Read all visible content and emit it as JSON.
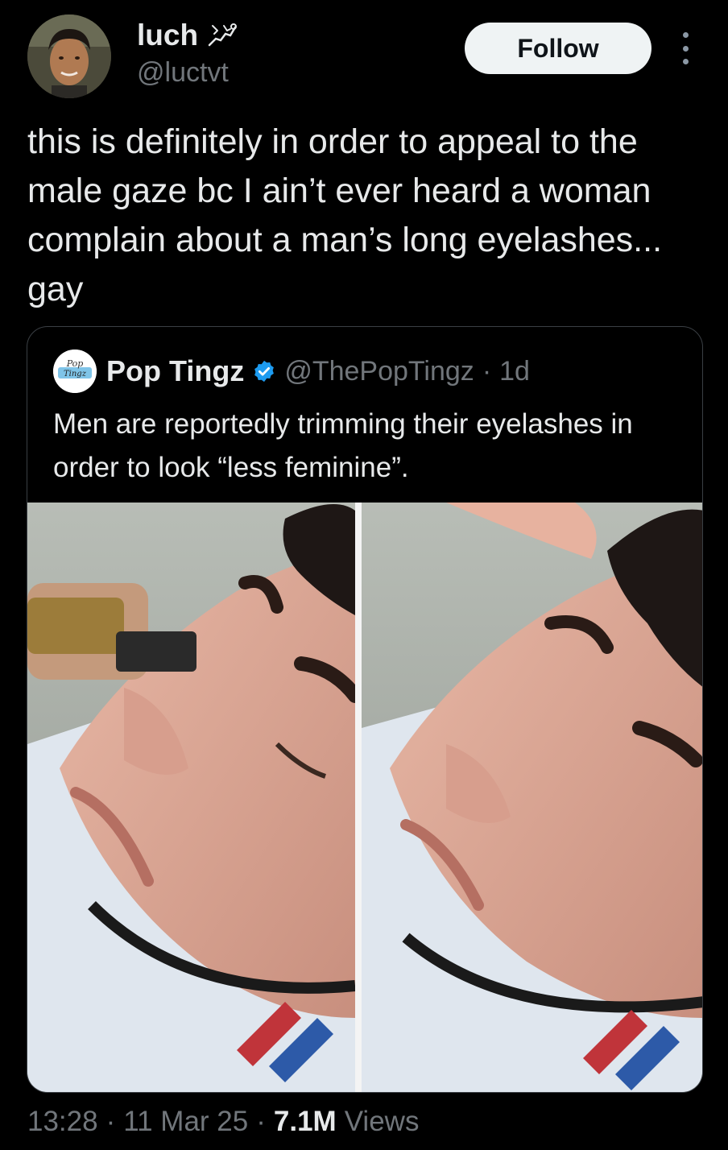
{
  "author": {
    "display_name": "luch",
    "handle": "@luctvt",
    "name_emoji": "lizard-icon"
  },
  "follow_label": "Follow",
  "tweet_text": "this is definitely in order to appeal to the male gaze bc I ain’t ever heard a woman complain about a man’s long eyelashes... gay",
  "quoted": {
    "display_name": "Pop Tingz",
    "handle": "@ThePopTingz",
    "separator": "·",
    "time": "1d",
    "text": "Men are reportedly trimming their eyelashes in order to look “less feminine”.",
    "verified": true,
    "media_description_icons": [
      "photo-trimming-eyelashes",
      "photo-after-trim"
    ]
  },
  "footer": {
    "time": "13:28",
    "sep1": "·",
    "date": "11 Mar 25",
    "sep2": "·",
    "views_count": "7.1M",
    "views_label": "Views"
  },
  "colors": {
    "background": "#000000",
    "text": "#e7e9ea",
    "secondary": "#71767b",
    "verified": "#1d9bf0",
    "follow_bg": "#eff3f4"
  }
}
